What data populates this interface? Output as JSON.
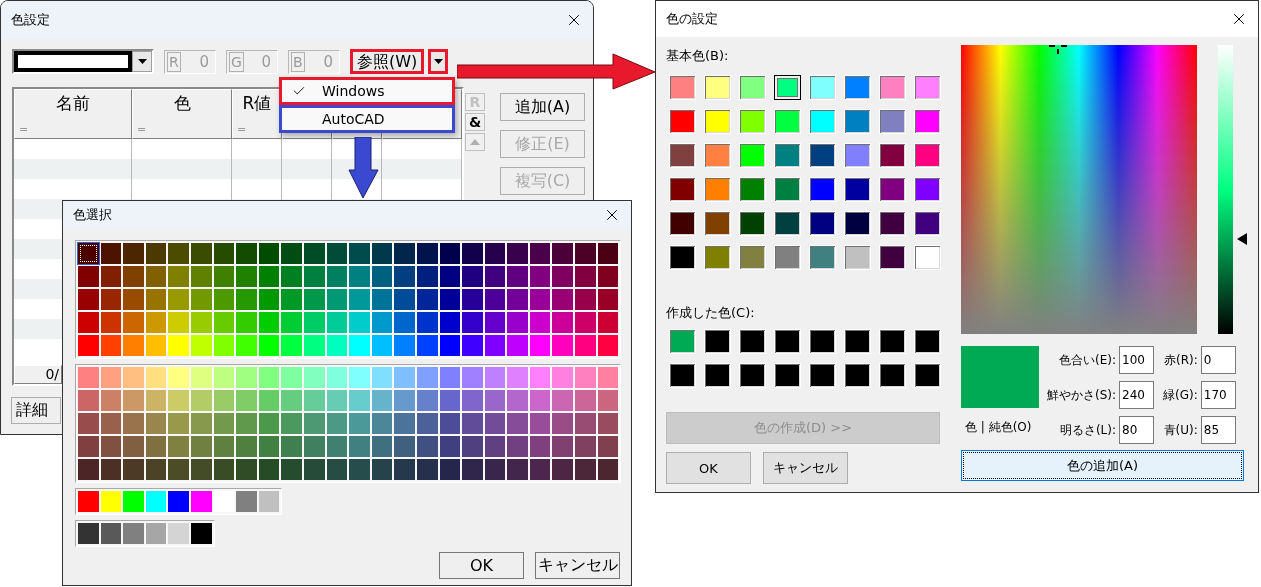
{
  "color_settings": {
    "title": "色設定",
    "swatch": {
      "color": "#ffffff"
    },
    "rgb_fields": [
      {
        "label": "R",
        "value": "0",
        "disabled": true
      },
      {
        "label": "G",
        "value": "0",
        "disabled": true
      },
      {
        "label": "B",
        "value": "0",
        "disabled": true
      }
    ],
    "reference_button": {
      "label": "参照(W)",
      "color": "#e8192c"
    },
    "dropdown_button": {
      "color": "#e8192c"
    },
    "menu": [
      {
        "label": "Windows",
        "checked": true,
        "color": "#e8192c"
      },
      {
        "label": "AutoCAD",
        "checked": false,
        "color": "#3b48d0"
      }
    ],
    "table": {
      "columns": [
        {
          "label": "名前",
          "marker": "="
        },
        {
          "label": "色",
          "marker": "="
        },
        {
          "label": "R値",
          "marker": "="
        }
      ]
    },
    "side_buttons": [
      {
        "label": "R",
        "disabled": true
      },
      {
        "label": "&",
        "disabled": false
      }
    ],
    "buttons": [
      {
        "label": "追加(A)",
        "disabled": false
      },
      {
        "label": "修正(E)",
        "disabled": true
      },
      {
        "label": "複写(C)",
        "disabled": true
      }
    ],
    "status": "0/",
    "detail_button": "詳細"
  },
  "palette_dialog": {
    "title": "色選択",
    "palette_top": [
      [
        {
          "color": "#4c0000",
          "selected": true
        },
        {
          "color": "#4c1300",
          "selected": false
        },
        {
          "color": "#4c2600",
          "selected": false
        },
        {
          "color": "#4c3900",
          "selected": false
        },
        {
          "color": "#4c4c00",
          "selected": false
        },
        {
          "color": "#394c00",
          "selected": false
        },
        {
          "color": "#264c00",
          "selected": false
        },
        {
          "color": "#134c00",
          "selected": false
        },
        {
          "color": "#004c00",
          "selected": false
        },
        {
          "color": "#004c13",
          "selected": false
        },
        {
          "color": "#004c26",
          "selected": false
        },
        {
          "color": "#004c39",
          "selected": false
        },
        {
          "color": "#004c4c",
          "selected": false
        },
        {
          "color": "#00394c",
          "selected": false
        },
        {
          "color": "#00264c",
          "selected": false
        },
        {
          "color": "#00134c",
          "selected": false
        },
        {
          "color": "#00004c",
          "selected": false
        },
        {
          "color": "#13004c",
          "selected": false
        },
        {
          "color": "#26004c",
          "selected": false
        },
        {
          "color": "#39004c",
          "selected": false
        },
        {
          "color": "#4c004c",
          "selected": false
        },
        {
          "color": "#4c0039",
          "selected": false
        },
        {
          "color": "#4c0026",
          "selected": false
        },
        {
          "color": "#4c0013",
          "selected": false
        }
      ],
      [
        {
          "color": "#800000",
          "selected": false
        },
        {
          "color": "#802000",
          "selected": false
        },
        {
          "color": "#804000",
          "selected": false
        },
        {
          "color": "#806000",
          "selected": false
        },
        {
          "color": "#808000",
          "selected": false
        },
        {
          "color": "#608000",
          "selected": false
        },
        {
          "color": "#408000",
          "selected": false
        },
        {
          "color": "#208000",
          "selected": false
        },
        {
          "color": "#008000",
          "selected": false
        },
        {
          "color": "#008020",
          "selected": false
        },
        {
          "color": "#008040",
          "selected": false
        },
        {
          "color": "#008060",
          "selected": false
        },
        {
          "color": "#008080",
          "selected": false
        },
        {
          "color": "#006080",
          "selected": false
        },
        {
          "color": "#004080",
          "selected": false
        },
        {
          "color": "#002080",
          "selected": false
        },
        {
          "color": "#000080",
          "selected": false
        },
        {
          "color": "#200080",
          "selected": false
        },
        {
          "color": "#400080",
          "selected": false
        },
        {
          "color": "#600080",
          "selected": false
        },
        {
          "color": "#800080",
          "selected": false
        },
        {
          "color": "#800060",
          "selected": false
        },
        {
          "color": "#800040",
          "selected": false
        },
        {
          "color": "#800020",
          "selected": false
        }
      ],
      [
        {
          "color": "#990000",
          "selected": false
        },
        {
          "color": "#992600",
          "selected": false
        },
        {
          "color": "#994c00",
          "selected": false
        },
        {
          "color": "#997300",
          "selected": false
        },
        {
          "color": "#999900",
          "selected": false
        },
        {
          "color": "#739900",
          "selected": false
        },
        {
          "color": "#4c9900",
          "selected": false
        },
        {
          "color": "#269900",
          "selected": false
        },
        {
          "color": "#009900",
          "selected": false
        },
        {
          "color": "#009926",
          "selected": false
        },
        {
          "color": "#00994c",
          "selected": false
        },
        {
          "color": "#009973",
          "selected": false
        },
        {
          "color": "#009999",
          "selected": false
        },
        {
          "color": "#007399",
          "selected": false
        },
        {
          "color": "#004c99",
          "selected": false
        },
        {
          "color": "#002699",
          "selected": false
        },
        {
          "color": "#000099",
          "selected": false
        },
        {
          "color": "#260099",
          "selected": false
        },
        {
          "color": "#4c0099",
          "selected": false
        },
        {
          "color": "#730099",
          "selected": false
        },
        {
          "color": "#990099",
          "selected": false
        },
        {
          "color": "#990073",
          "selected": false
        },
        {
          "color": "#99004c",
          "selected": false
        },
        {
          "color": "#990026",
          "selected": false
        }
      ],
      [
        {
          "color": "#cc0000",
          "selected": false
        },
        {
          "color": "#cc3300",
          "selected": false
        },
        {
          "color": "#cc6600",
          "selected": false
        },
        {
          "color": "#cc9900",
          "selected": false
        },
        {
          "color": "#cccc00",
          "selected": false
        },
        {
          "color": "#99cc00",
          "selected": false
        },
        {
          "color": "#66cc00",
          "selected": false
        },
        {
          "color": "#33cc00",
          "selected": false
        },
        {
          "color": "#00cc00",
          "selected": false
        },
        {
          "color": "#00cc33",
          "selected": false
        },
        {
          "color": "#00cc66",
          "selected": false
        },
        {
          "color": "#00cc99",
          "selected": false
        },
        {
          "color": "#00cccc",
          "selected": false
        },
        {
          "color": "#0099cc",
          "selected": false
        },
        {
          "color": "#0066cc",
          "selected": false
        },
        {
          "color": "#0033cc",
          "selected": false
        },
        {
          "color": "#0000cc",
          "selected": false
        },
        {
          "color": "#3300cc",
          "selected": false
        },
        {
          "color": "#6600cc",
          "selected": false
        },
        {
          "color": "#9900cc",
          "selected": false
        },
        {
          "color": "#cc00cc",
          "selected": false
        },
        {
          "color": "#cc0099",
          "selected": false
        },
        {
          "color": "#cc0066",
          "selected": false
        },
        {
          "color": "#cc0033",
          "selected": false
        }
      ],
      [
        {
          "color": "#ff0000",
          "selected": false
        },
        {
          "color": "#ff4000",
          "selected": false
        },
        {
          "color": "#ff8000",
          "selected": false
        },
        {
          "color": "#ffbf00",
          "selected": false
        },
        {
          "color": "#ffff00",
          "selected": false
        },
        {
          "color": "#bfff00",
          "selected": false
        },
        {
          "color": "#80ff00",
          "selected": false
        },
        {
          "color": "#40ff00",
          "selected": false
        },
        {
          "color": "#00ff00",
          "selected": false
        },
        {
          "color": "#00ff40",
          "selected": false
        },
        {
          "color": "#00ff80",
          "selected": false
        },
        {
          "color": "#00ffbf",
          "selected": false
        },
        {
          "color": "#00ffff",
          "selected": false
        },
        {
          "color": "#00bfff",
          "selected": false
        },
        {
          "color": "#0080ff",
          "selected": false
        },
        {
          "color": "#0040ff",
          "selected": false
        },
        {
          "color": "#0000ff",
          "selected": false
        },
        {
          "color": "#4000ff",
          "selected": false
        },
        {
          "color": "#8000ff",
          "selected": false
        },
        {
          "color": "#bf00ff",
          "selected": false
        },
        {
          "color": "#ff00ff",
          "selected": false
        },
        {
          "color": "#ff00bf",
          "selected": false
        },
        {
          "color": "#ff0080",
          "selected": false
        },
        {
          "color": "#ff0040",
          "selected": false
        }
      ]
    ],
    "palette_bottom": [
      [
        {
          "color": "#ff8080",
          "selected": false
        },
        {
          "color": "#ffa080",
          "selected": false
        },
        {
          "color": "#ffbf80",
          "selected": false
        },
        {
          "color": "#ffdf80",
          "selected": false
        },
        {
          "color": "#ffff80",
          "selected": false
        },
        {
          "color": "#dfff80",
          "selected": false
        },
        {
          "color": "#bfff80",
          "selected": false
        },
        {
          "color": "#a0ff80",
          "selected": false
        },
        {
          "color": "#80ff80",
          "selected": false
        },
        {
          "color": "#80ffa0",
          "selected": false
        },
        {
          "color": "#80ffbf",
          "selected": false
        },
        {
          "color": "#80ffdf",
          "selected": false
        },
        {
          "color": "#80ffff",
          "selected": false
        },
        {
          "color": "#80dfff",
          "selected": false
        },
        {
          "color": "#80bfff",
          "selected": false
        },
        {
          "color": "#80a0ff",
          "selected": false
        },
        {
          "color": "#8080ff",
          "selected": false
        },
        {
          "color": "#a080ff",
          "selected": false
        },
        {
          "color": "#bf80ff",
          "selected": false
        },
        {
          "color": "#df80ff",
          "selected": false
        },
        {
          "color": "#ff80ff",
          "selected": false
        },
        {
          "color": "#ff80df",
          "selected": false
        },
        {
          "color": "#ff80bf",
          "selected": false
        },
        {
          "color": "#ff80a0",
          "selected": false
        }
      ],
      [
        {
          "color": "#cc6666",
          "selected": false
        },
        {
          "color": "#cc8066",
          "selected": false
        },
        {
          "color": "#cc9966",
          "selected": false
        },
        {
          "color": "#ccb366",
          "selected": false
        },
        {
          "color": "#cccc66",
          "selected": false
        },
        {
          "color": "#b3cc66",
          "selected": false
        },
        {
          "color": "#99cc66",
          "selected": false
        },
        {
          "color": "#80cc66",
          "selected": false
        },
        {
          "color": "#66cc66",
          "selected": false
        },
        {
          "color": "#66cc80",
          "selected": false
        },
        {
          "color": "#66cc99",
          "selected": false
        },
        {
          "color": "#66ccb3",
          "selected": false
        },
        {
          "color": "#66cccc",
          "selected": false
        },
        {
          "color": "#66b3cc",
          "selected": false
        },
        {
          "color": "#6699cc",
          "selected": false
        },
        {
          "color": "#6680cc",
          "selected": false
        },
        {
          "color": "#6666cc",
          "selected": false
        },
        {
          "color": "#8066cc",
          "selected": false
        },
        {
          "color": "#9966cc",
          "selected": false
        },
        {
          "color": "#b366cc",
          "selected": false
        },
        {
          "color": "#cc66cc",
          "selected": false
        },
        {
          "color": "#cc66b3",
          "selected": false
        },
        {
          "color": "#cc6699",
          "selected": false
        },
        {
          "color": "#cc6680",
          "selected": false
        }
      ],
      [
        {
          "color": "#994c4c",
          "selected": false
        },
        {
          "color": "#99604c",
          "selected": false
        },
        {
          "color": "#99734c",
          "selected": false
        },
        {
          "color": "#99864c",
          "selected": false
        },
        {
          "color": "#99994c",
          "selected": false
        },
        {
          "color": "#86994c",
          "selected": false
        },
        {
          "color": "#73994c",
          "selected": false
        },
        {
          "color": "#60994c",
          "selected": false
        },
        {
          "color": "#4c994c",
          "selected": false
        },
        {
          "color": "#4c9960",
          "selected": false
        },
        {
          "color": "#4c9973",
          "selected": false
        },
        {
          "color": "#4c9986",
          "selected": false
        },
        {
          "color": "#4c9999",
          "selected": false
        },
        {
          "color": "#4c8699",
          "selected": false
        },
        {
          "color": "#4c7399",
          "selected": false
        },
        {
          "color": "#4c6099",
          "selected": false
        },
        {
          "color": "#4c4c99",
          "selected": false
        },
        {
          "color": "#604c99",
          "selected": false
        },
        {
          "color": "#734c99",
          "selected": false
        },
        {
          "color": "#864c99",
          "selected": false
        },
        {
          "color": "#994c99",
          "selected": false
        },
        {
          "color": "#994c86",
          "selected": false
        },
        {
          "color": "#994c73",
          "selected": false
        },
        {
          "color": "#994c60",
          "selected": false
        }
      ],
      [
        {
          "color": "#804040",
          "selected": false
        },
        {
          "color": "#805040",
          "selected": false
        },
        {
          "color": "#806040",
          "selected": false
        },
        {
          "color": "#807040",
          "selected": false
        },
        {
          "color": "#808040",
          "selected": false
        },
        {
          "color": "#708040",
          "selected": false
        },
        {
          "color": "#608040",
          "selected": false
        },
        {
          "color": "#508040",
          "selected": false
        },
        {
          "color": "#408040",
          "selected": false
        },
        {
          "color": "#408050",
          "selected": false
        },
        {
          "color": "#408060",
          "selected": false
        },
        {
          "color": "#408070",
          "selected": false
        },
        {
          "color": "#408080",
          "selected": false
        },
        {
          "color": "#407080",
          "selected": false
        },
        {
          "color": "#406080",
          "selected": false
        },
        {
          "color": "#405080",
          "selected": false
        },
        {
          "color": "#404080",
          "selected": false
        },
        {
          "color": "#504080",
          "selected": false
        },
        {
          "color": "#604080",
          "selected": false
        },
        {
          "color": "#704080",
          "selected": false
        },
        {
          "color": "#804080",
          "selected": false
        },
        {
          "color": "#804070",
          "selected": false
        },
        {
          "color": "#804060",
          "selected": false
        },
        {
          "color": "#804050",
          "selected": false
        }
      ],
      [
        {
          "color": "#4c2626",
          "selected": false
        },
        {
          "color": "#4c3026",
          "selected": false
        },
        {
          "color": "#4c3926",
          "selected": false
        },
        {
          "color": "#4c4326",
          "selected": false
        },
        {
          "color": "#4c4c26",
          "selected": false
        },
        {
          "color": "#434c26",
          "selected": false
        },
        {
          "color": "#394c26",
          "selected": false
        },
        {
          "color": "#304c26",
          "selected": false
        },
        {
          "color": "#264c26",
          "selected": false
        },
        {
          "color": "#264c30",
          "selected": false
        },
        {
          "color": "#264c39",
          "selected": false
        },
        {
          "color": "#264c43",
          "selected": false
        },
        {
          "color": "#264c4c",
          "selected": false
        },
        {
          "color": "#26434c",
          "selected": false
        },
        {
          "color": "#26394c",
          "selected": false
        },
        {
          "color": "#26304c",
          "selected": false
        },
        {
          "color": "#26264c",
          "selected": false
        },
        {
          "color": "#30264c",
          "selected": false
        },
        {
          "color": "#39264c",
          "selected": false
        },
        {
          "color": "#43264c",
          "selected": false
        },
        {
          "color": "#4c264c",
          "selected": false
        },
        {
          "color": "#4c2643",
          "selected": false
        },
        {
          "color": "#4c2639",
          "selected": false
        },
        {
          "color": "#4c2630",
          "selected": false
        }
      ]
    ],
    "extra_rows": [
      [
        {
          "color": "#ff0000",
          "selected": false
        },
        {
          "color": "#ffff00",
          "selected": false
        },
        {
          "color": "#00ff00",
          "selected": false
        },
        {
          "color": "#00ffff",
          "selected": false
        },
        {
          "color": "#0000ff",
          "selected": false
        },
        {
          "color": "#ff00ff",
          "selected": false
        },
        {
          "color": "#ffffff",
          "selected": false
        },
        {
          "color": "#808080",
          "selected": false
        },
        {
          "color": "#c0c0c0",
          "selected": false
        }
      ],
      [
        {
          "color": "#333333",
          "selected": false
        },
        {
          "color": "#595959",
          "selected": false
        },
        {
          "color": "#808080",
          "selected": false
        },
        {
          "color": "#a6a6a6",
          "selected": false
        },
        {
          "color": "#d4d4d4",
          "selected": false
        },
        {
          "color": "#000000",
          "selected": false
        }
      ]
    ],
    "buttons": [
      "OK",
      "キャンセル"
    ]
  },
  "windows_color_dialog": {
    "title": "色の設定",
    "basic_label": "基本色(B):",
    "basic_colors": [
      [
        {
          "color": "#ff8080",
          "selected": false
        },
        {
          "color": "#ffff80",
          "selected": false
        },
        {
          "color": "#80ff80",
          "selected": false
        },
        {
          "color": "#00ff80",
          "selected": true
        },
        {
          "color": "#80ffff",
          "selected": false
        },
        {
          "color": "#0080ff",
          "selected": false
        },
        {
          "color": "#ff80c0",
          "selected": false
        },
        {
          "color": "#ff80ff",
          "selected": false
        }
      ],
      [
        {
          "color": "#ff0000",
          "selected": false
        },
        {
          "color": "#ffff00",
          "selected": false
        },
        {
          "color": "#80ff00",
          "selected": false
        },
        {
          "color": "#00ff40",
          "selected": false
        },
        {
          "color": "#00ffff",
          "selected": false
        },
        {
          "color": "#0080c0",
          "selected": false
        },
        {
          "color": "#8080c0",
          "selected": false
        },
        {
          "color": "#ff00ff",
          "selected": false
        }
      ],
      [
        {
          "color": "#804040",
          "selected": false
        },
        {
          "color": "#ff8040",
          "selected": false
        },
        {
          "color": "#00ff00",
          "selected": false
        },
        {
          "color": "#008080",
          "selected": false
        },
        {
          "color": "#004080",
          "selected": false
        },
        {
          "color": "#8080ff",
          "selected": false
        },
        {
          "color": "#800040",
          "selected": false
        },
        {
          "color": "#ff0080",
          "selected": false
        }
      ],
      [
        {
          "color": "#800000",
          "selected": false
        },
        {
          "color": "#ff8000",
          "selected": false
        },
        {
          "color": "#008000",
          "selected": false
        },
        {
          "color": "#008040",
          "selected": false
        },
        {
          "color": "#0000ff",
          "selected": false
        },
        {
          "color": "#0000a0",
          "selected": false
        },
        {
          "color": "#800080",
          "selected": false
        },
        {
          "color": "#8000ff",
          "selected": false
        }
      ],
      [
        {
          "color": "#400000",
          "selected": false
        },
        {
          "color": "#804000",
          "selected": false
        },
        {
          "color": "#004000",
          "selected": false
        },
        {
          "color": "#004040",
          "selected": false
        },
        {
          "color": "#000080",
          "selected": false
        },
        {
          "color": "#000040",
          "selected": false
        },
        {
          "color": "#400040",
          "selected": false
        },
        {
          "color": "#400080",
          "selected": false
        }
      ],
      [
        {
          "color": "#000000",
          "selected": false
        },
        {
          "color": "#808000",
          "selected": false
        },
        {
          "color": "#808040",
          "selected": false
        },
        {
          "color": "#808080",
          "selected": false
        },
        {
          "color": "#408080",
          "selected": false
        },
        {
          "color": "#c0c0c0",
          "selected": false
        },
        {
          "color": "#400040",
          "selected": false
        },
        {
          "color": "#ffffff",
          "selected": false
        }
      ]
    ],
    "custom_label": "作成した色(C):",
    "custom_colors": [
      [
        {
          "color": "#00aa55"
        },
        {
          "color": "#000000"
        },
        {
          "color": "#000000"
        },
        {
          "color": "#000000"
        },
        {
          "color": "#000000"
        },
        {
          "color": "#000000"
        },
        {
          "color": "#000000"
        },
        {
          "color": "#000000"
        }
      ],
      [
        {
          "color": "#000000"
        },
        {
          "color": "#000000"
        },
        {
          "color": "#000000"
        },
        {
          "color": "#000000"
        },
        {
          "color": "#000000"
        },
        {
          "color": "#000000"
        },
        {
          "color": "#000000"
        },
        {
          "color": "#000000"
        }
      ]
    ],
    "define_button": {
      "label": "色の作成(D) >>",
      "disabled": true
    },
    "ok_button": "OK",
    "cancel_button": "キャンセル",
    "luminance_slider": {
      "level": 0.33
    },
    "preview": {
      "color": "#00aa55"
    },
    "preview_label": "色 | 純色(O)",
    "fields": [
      {
        "label": "色合い(E):",
        "value": "100"
      },
      {
        "label": "赤(R):",
        "value": "0"
      },
      {
        "label": "鮮やかさ(S):",
        "value": "240"
      },
      {
        "label": "緑(G):",
        "value": "170"
      },
      {
        "label": "明るさ(L):",
        "value": "80"
      },
      {
        "label": "青(U):",
        "value": "85"
      }
    ],
    "add_button": "色の追加(A)"
  }
}
